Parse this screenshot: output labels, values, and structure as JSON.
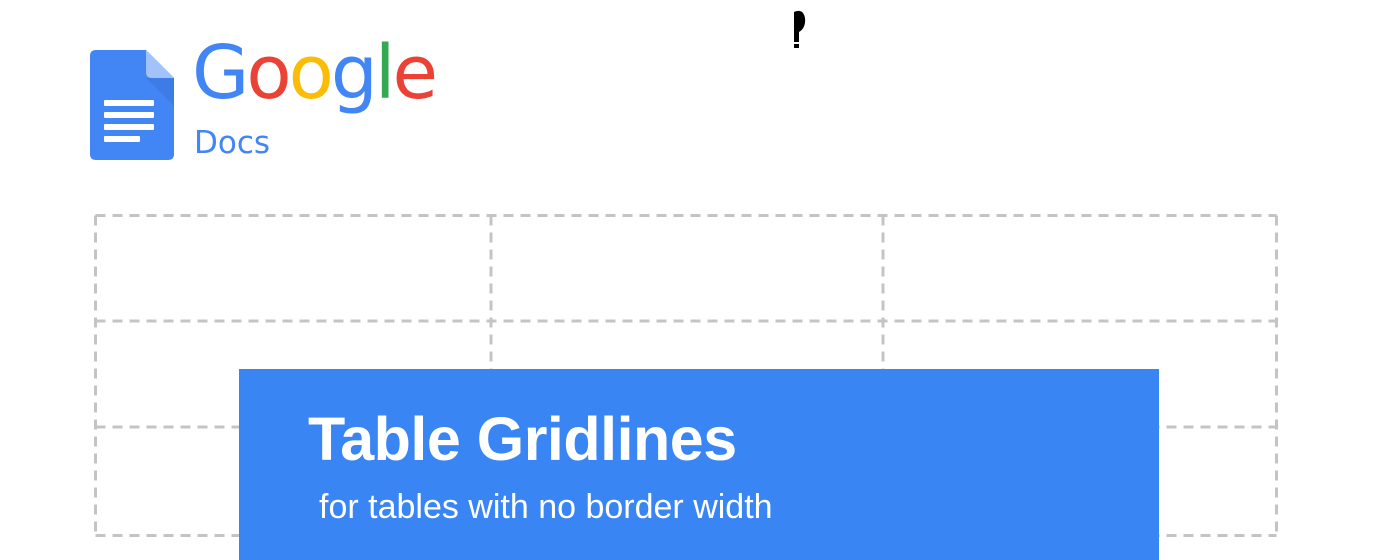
{
  "logo": {
    "wordmark_letters": [
      {
        "char": "G",
        "color": "#4285f4"
      },
      {
        "char": "o",
        "color": "#ea4335"
      },
      {
        "char": "o",
        "color": "#fbbc05"
      },
      {
        "char": "g",
        "color": "#4285f4"
      },
      {
        "char": "l",
        "color": "#34a853"
      },
      {
        "char": "e",
        "color": "#ea4335"
      }
    ],
    "product": "Docs",
    "icon": "google-docs-icon"
  },
  "table": {
    "rows": 3,
    "columns": 3,
    "gridline_style": "dashed",
    "gridline_color": "#c4c4c4"
  },
  "card": {
    "title": "Table Gridlines",
    "subtitle": "for tables with no border width",
    "background": "#3885f3"
  }
}
